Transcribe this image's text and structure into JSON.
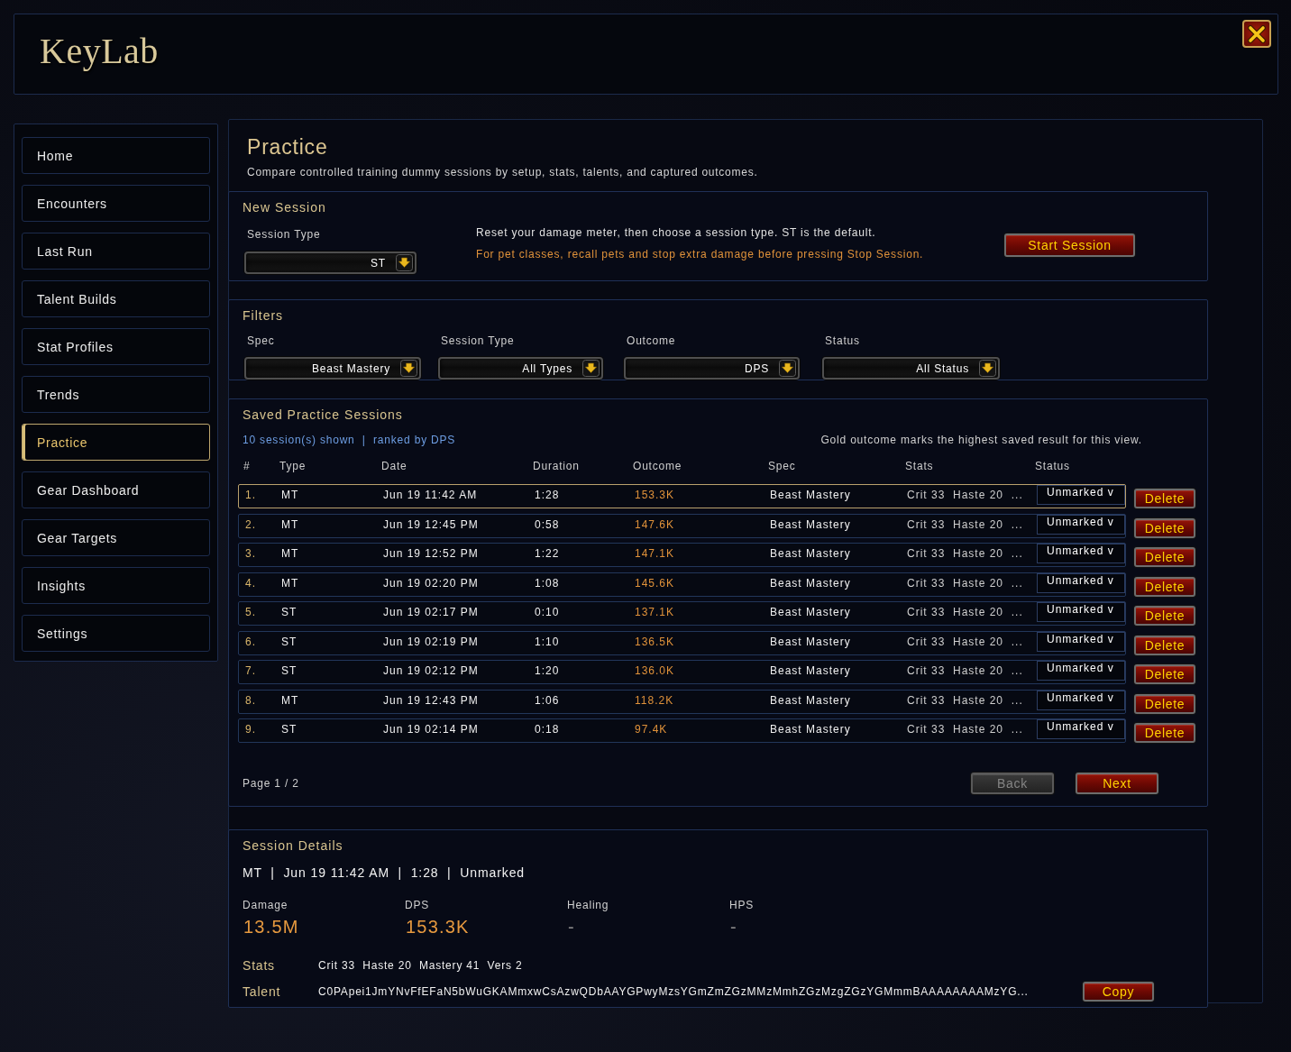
{
  "header": {
    "title": "KeyLab"
  },
  "sidebar": {
    "items": [
      {
        "label": "Home",
        "selected": false
      },
      {
        "label": "Encounters",
        "selected": false
      },
      {
        "label": "Last Run",
        "selected": false
      },
      {
        "label": "Talent Builds",
        "selected": false
      },
      {
        "label": "Stat Profiles",
        "selected": false
      },
      {
        "label": "Trends",
        "selected": false
      },
      {
        "label": "Practice",
        "selected": true
      },
      {
        "label": "Gear Dashboard",
        "selected": false
      },
      {
        "label": "Gear Targets",
        "selected": false
      },
      {
        "label": "Insights",
        "selected": false
      },
      {
        "label": "Settings",
        "selected": false
      }
    ]
  },
  "page": {
    "title": "Practice",
    "subtitle": "Compare controlled training dummy sessions by setup, stats, talents, and captured outcomes."
  },
  "new_session": {
    "title": "New Session",
    "session_type": {
      "label": "Session Type",
      "value": "ST"
    },
    "messages": [
      {
        "text": "Reset your damage meter, then choose a session type. ST is the default.",
        "kind": "info"
      },
      {
        "text": "For pet classes, recall pets and stop extra damage before pressing Stop Session.",
        "kind": "warning"
      }
    ],
    "start_button": "Start Session"
  },
  "filters": {
    "title": "Filters",
    "fields": [
      {
        "label": "Spec",
        "value": "Beast Mastery"
      },
      {
        "label": "Session Type",
        "value": "All Types"
      },
      {
        "label": "Outcome",
        "value": "DPS"
      },
      {
        "label": "Status",
        "value": "All Status"
      }
    ]
  },
  "sessions": {
    "title": "Saved Practice Sessions",
    "summary": "10 session(s) shown  |  ranked by DPS",
    "legend": "Gold outcome marks the highest saved result for this view.",
    "columns": [
      "#",
      "Type",
      "Date",
      "Duration",
      "Outcome",
      "Spec",
      "Stats",
      "Status"
    ],
    "rows": [
      {
        "index": "1.",
        "type": "MT",
        "date": "Jun 19 11:42 AM",
        "duration": "1:28",
        "outcome": "153.3K",
        "spec": "Beast Mastery",
        "stats": "Crit 33  Haste 20  ...",
        "status": "Unmarked v",
        "action": "Delete",
        "selected": true
      },
      {
        "index": "2.",
        "type": "MT",
        "date": "Jun 19 12:45 PM",
        "duration": "0:58",
        "outcome": "147.6K",
        "spec": "Beast Mastery",
        "stats": "Crit 33  Haste 20  ...",
        "status": "Unmarked v",
        "action": "Delete",
        "selected": false
      },
      {
        "index": "3.",
        "type": "MT",
        "date": "Jun 19 12:52 PM",
        "duration": "1:22",
        "outcome": "147.1K",
        "spec": "Beast Mastery",
        "stats": "Crit 33  Haste 20  ...",
        "status": "Unmarked v",
        "action": "Delete",
        "selected": false
      },
      {
        "index": "4.",
        "type": "MT",
        "date": "Jun 19 02:20 PM",
        "duration": "1:08",
        "outcome": "145.6K",
        "spec": "Beast Mastery",
        "stats": "Crit 33  Haste 20  ...",
        "status": "Unmarked v",
        "action": "Delete",
        "selected": false
      },
      {
        "index": "5.",
        "type": "ST",
        "date": "Jun 19 02:17 PM",
        "duration": "0:10",
        "outcome": "137.1K",
        "spec": "Beast Mastery",
        "stats": "Crit 33  Haste 20  ...",
        "status": "Unmarked v",
        "action": "Delete",
        "selected": false
      },
      {
        "index": "6.",
        "type": "ST",
        "date": "Jun 19 02:19 PM",
        "duration": "1:10",
        "outcome": "136.5K",
        "spec": "Beast Mastery",
        "stats": "Crit 33  Haste 20  ...",
        "status": "Unmarked v",
        "action": "Delete",
        "selected": false
      },
      {
        "index": "7.",
        "type": "ST",
        "date": "Jun 19 02:12 PM",
        "duration": "1:20",
        "outcome": "136.0K",
        "spec": "Beast Mastery",
        "stats": "Crit 33  Haste 20  ...",
        "status": "Unmarked v",
        "action": "Delete",
        "selected": false
      },
      {
        "index": "8.",
        "type": "MT",
        "date": "Jun 19 12:43 PM",
        "duration": "1:06",
        "outcome": "118.2K",
        "spec": "Beast Mastery",
        "stats": "Crit 33  Haste 20  ...",
        "status": "Unmarked v",
        "action": "Delete",
        "selected": false
      },
      {
        "index": "9.",
        "type": "ST",
        "date": "Jun 19 02:14 PM",
        "duration": "0:18",
        "outcome": "97.4K",
        "spec": "Beast Mastery",
        "stats": "Crit 33  Haste 20  ...",
        "status": "Unmarked v",
        "action": "Delete",
        "selected": false
      }
    ],
    "pagination": {
      "page": "Page 1 / 2",
      "back": {
        "label": "Back",
        "disabled": true
      },
      "next": {
        "label": "Next",
        "disabled": false
      }
    }
  },
  "details": {
    "title": "Session Details",
    "summary": "MT  |  Jun 19 11:42 AM  |  1:28  |  Unmarked",
    "metrics": [
      {
        "label": "Damage",
        "value": "13.5M",
        "muted": false
      },
      {
        "label": "DPS",
        "value": "153.3K",
        "muted": false
      },
      {
        "label": "Healing",
        "value": "-",
        "muted": true
      },
      {
        "label": "HPS",
        "value": "-",
        "muted": true
      }
    ],
    "stats": {
      "label": "Stats",
      "value": "Crit 33  Haste 20  Mastery 41  Vers 2"
    },
    "talent": {
      "label": "Talent",
      "value": "C0PApei1JmYNvFfEFaN5bWuGKAMmxwCsAzwQDbAAYGPwyMzsYGmZmZGzMMzMmhZGzMzgZGzYGMmmBAAAAAAAAMzYG...",
      "copy_button": "Copy"
    }
  }
}
